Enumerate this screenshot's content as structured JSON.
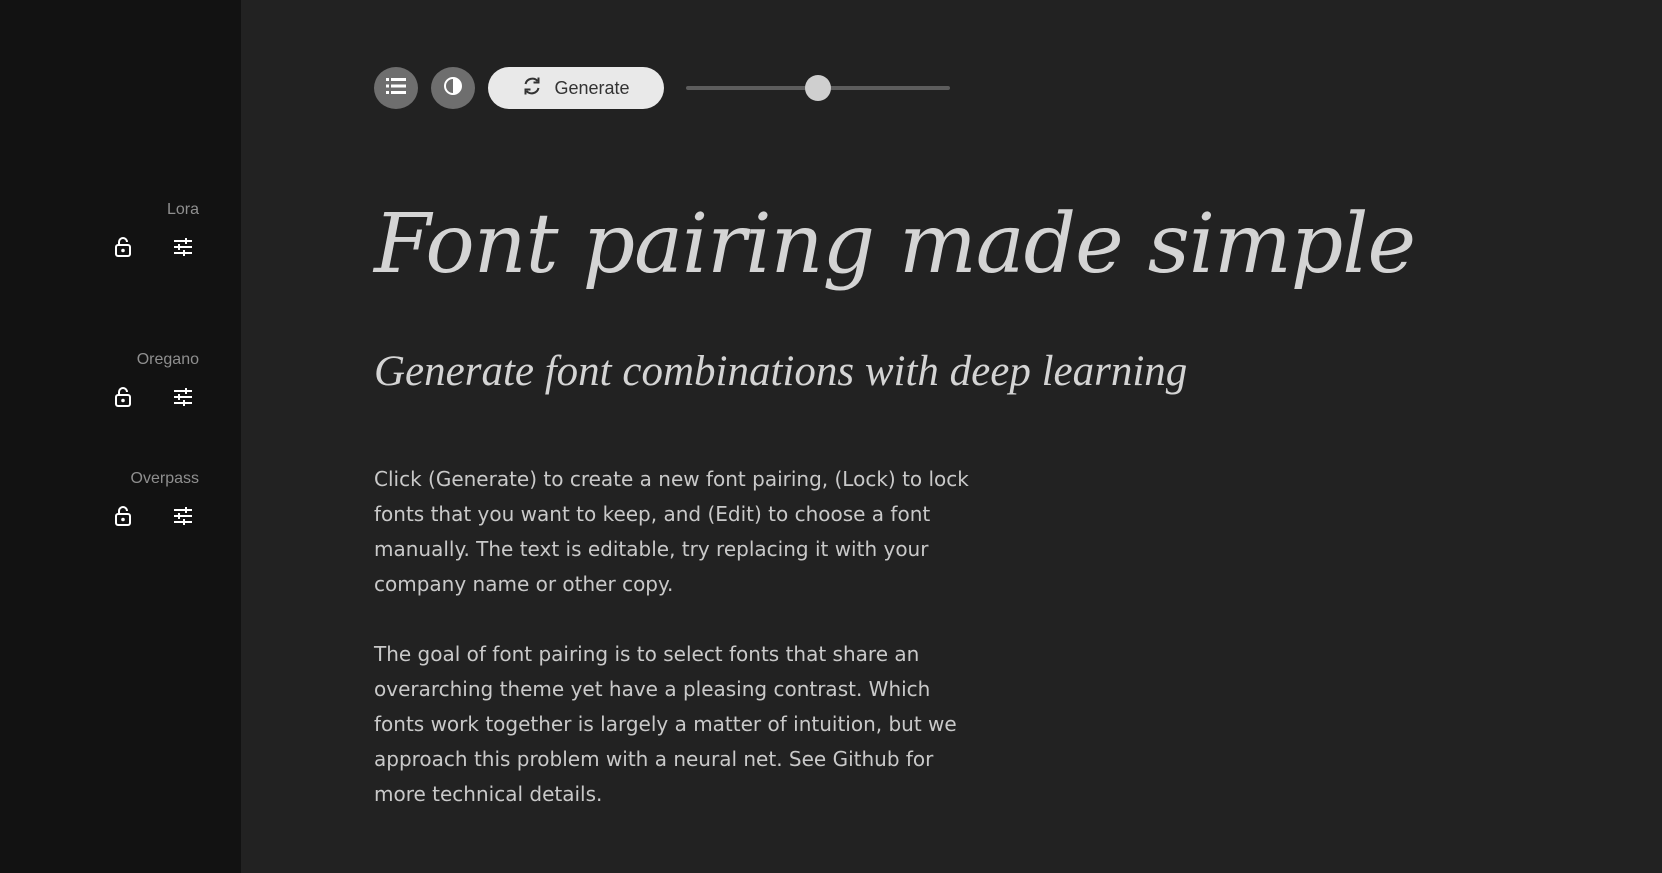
{
  "sidebar": {
    "fonts": [
      {
        "name": "Lora",
        "lock_icon": "lock-open-icon",
        "edit_icon": "sliders-icon"
      },
      {
        "name": "Oregano",
        "lock_icon": "lock-open-icon",
        "edit_icon": "sliders-icon"
      },
      {
        "name": "Overpass",
        "lock_icon": "lock-open-icon",
        "edit_icon": "sliders-icon"
      }
    ]
  },
  "toolbar": {
    "list_icon": "list-icon",
    "contrast_icon": "contrast-icon",
    "generate_icon": "refresh-icon",
    "generate_label": "Generate",
    "slider_value_fraction": 0.5
  },
  "content": {
    "headline": "Font pairing made simple",
    "subheadline": "Generate font combinations with deep learning",
    "paragraph1": "Click (Generate) to create a new font pairing, (Lock) to lock fonts that you want to keep, and (Edit) to choose a font manually. The text is editable, try replacing it with your company name or other copy.",
    "paragraph2": "The goal of font pairing is to select fonts that share an overarching theme yet have a pleasing contrast. Which fonts work together is largely a matter of intuition, but we approach this problem with a neural net. See Github for more technical details."
  },
  "colors": {
    "sidebar_bg": "#121212",
    "main_bg": "#222222",
    "text": "#d4d4d4",
    "muted_text": "#8f8f8f",
    "button_bg": "#6e6e6e",
    "generate_bg": "#e9e9e9"
  }
}
